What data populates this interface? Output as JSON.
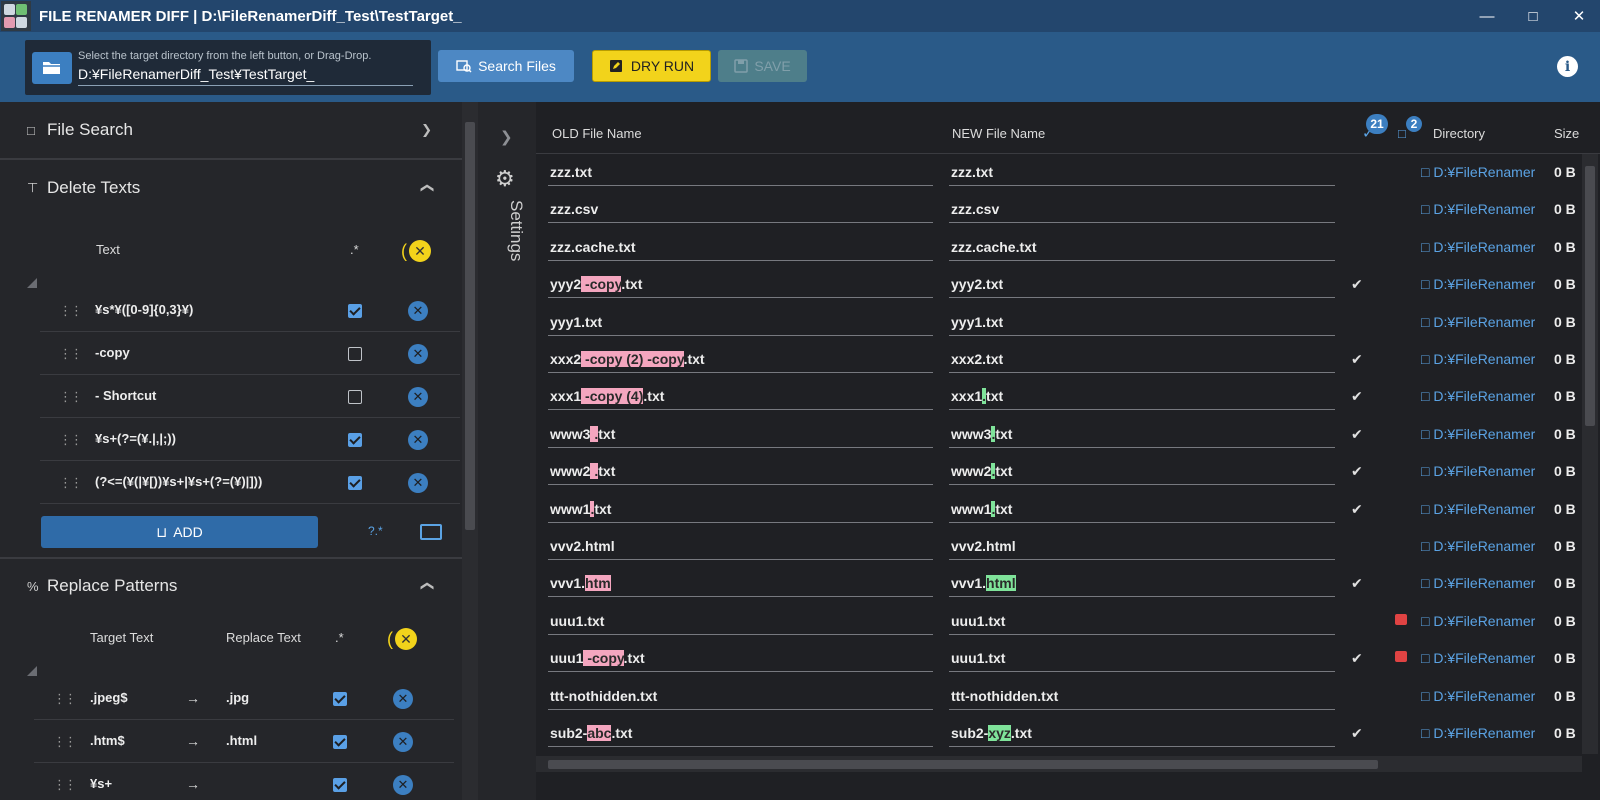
{
  "window": {
    "title": "FILE RENAMER DIFF | D:\\FileRenamerDiff_Test\\TestTarget_",
    "minimize_icon": "minimize-icon",
    "maximize_icon": "maximize-icon",
    "close_icon": "close-icon"
  },
  "toolbar": {
    "dir_hint": "Select the target directory from the left button, or Drag-Drop.",
    "dir_value": "D:¥FileRenamerDiff_Test¥TestTarget_",
    "search_label": "Search Files",
    "dryrun_label": "DRY RUN",
    "save_label": "SAVE"
  },
  "left": {
    "file_search": {
      "title": "File Search",
      "expanded": false
    },
    "delete_texts": {
      "title": "Delete Texts",
      "col_text": "Text",
      "col_regex": ".*",
      "items": [
        {
          "text": "¥s*¥([0-9]{0,3}¥)",
          "regex": true
        },
        {
          "text": " -copy",
          "regex": false
        },
        {
          "text": "- Shortcut",
          "regex": false
        },
        {
          "text": "¥s+(?=(¥.|,|;))",
          "regex": true
        },
        {
          "text": "(?<=(¥(|¥[))¥s+|¥s+(?=(¥)|]))",
          "regex": true
        }
      ],
      "add_label": "ADD",
      "help_label": "?.*"
    },
    "replace_patterns": {
      "title": "Replace Patterns",
      "col_target": "Target Text",
      "col_replace": "Replace Text",
      "col_regex": ".*",
      "items": [
        {
          "target": ".jpeg$",
          "replace": ".jpg",
          "regex": true
        },
        {
          "target": ".htm$",
          "replace": ".html",
          "regex": true
        },
        {
          "target": "¥s+",
          "replace": "",
          "regex": true
        }
      ]
    }
  },
  "settings": {
    "label": "Settings"
  },
  "grid": {
    "headers": {
      "old": "OLD File Name",
      "new": "NEW File Name",
      "directory": "Directory",
      "size": "Size"
    },
    "check_count": "21",
    "warn_count": "2",
    "rows": [
      {
        "old": [
          [
            "zzz.txt",
            ""
          ]
        ],
        "new": [
          [
            "zzz.txt",
            ""
          ]
        ],
        "changed": false,
        "warn": false,
        "dir": "D:¥FileRenamerDiff_Test¥TestTarget_",
        "size": "0 B"
      },
      {
        "old": [
          [
            "zzz.csv",
            ""
          ]
        ],
        "new": [
          [
            "zzz.csv",
            ""
          ]
        ],
        "changed": false,
        "warn": false,
        "dir": "D:¥FileRenamerDiff_Test¥TestTarget_",
        "size": "0 B"
      },
      {
        "old": [
          [
            "zzz.cache.txt",
            ""
          ]
        ],
        "new": [
          [
            "zzz.cache.txt",
            ""
          ]
        ],
        "changed": false,
        "warn": false,
        "dir": "D:¥FileRenamerDiff_Test¥TestTarget_",
        "size": "0 B"
      },
      {
        "old": [
          [
            "yyy2",
            ""
          ],
          [
            " -copy",
            "d"
          ],
          [
            ".txt",
            ""
          ]
        ],
        "new": [
          [
            "yyy2.txt",
            ""
          ]
        ],
        "changed": true,
        "warn": false,
        "dir": "D:¥FileRenamerDiff_Test¥TestTarget_",
        "size": "0 B"
      },
      {
        "old": [
          [
            "yyy1.txt",
            ""
          ]
        ],
        "new": [
          [
            "yyy1.txt",
            ""
          ]
        ],
        "changed": false,
        "warn": false,
        "dir": "D:¥FileRenamerDiff_Test¥TestTarget_",
        "size": "0 B"
      },
      {
        "old": [
          [
            "xxx2",
            ""
          ],
          [
            " -copy (2) -copy",
            "d"
          ],
          [
            ".txt",
            ""
          ]
        ],
        "new": [
          [
            "xxx2.txt",
            ""
          ]
        ],
        "changed": true,
        "warn": false,
        "dir": "D:¥FileRenamerDiff_Test¥TestTarget_",
        "size": "0 B"
      },
      {
        "old": [
          [
            "xxx1",
            ""
          ],
          [
            " -copy (4)",
            "d"
          ],
          [
            ".txt",
            ""
          ]
        ],
        "new": [
          [
            "xxx1",
            ""
          ],
          [
            ".",
            "i"
          ],
          [
            "txt",
            ""
          ]
        ],
        "changed": true,
        "warn": false,
        "dir": "D:¥FileRenamerDiff_Test¥TestTarget_",
        "size": "0 B"
      },
      {
        "old": [
          [
            "www3",
            ""
          ],
          [
            "  .",
            "d"
          ],
          [
            "txt",
            ""
          ]
        ],
        "new": [
          [
            "www3",
            ""
          ],
          [
            ".",
            "i"
          ],
          [
            "txt",
            ""
          ]
        ],
        "changed": true,
        "warn": false,
        "dir": "D:¥FileRenamerDiff_Test¥TestTarget_",
        "size": "0 B"
      },
      {
        "old": [
          [
            "www2",
            ""
          ],
          [
            " .",
            "d"
          ],
          [
            "txt",
            ""
          ]
        ],
        "new": [
          [
            "www2",
            ""
          ],
          [
            ".",
            "i"
          ],
          [
            "txt",
            ""
          ]
        ],
        "changed": true,
        "warn": false,
        "dir": "D:¥FileRenamerDiff_Test¥TestTarget_",
        "size": "0 B"
      },
      {
        "old": [
          [
            "www1",
            ""
          ],
          [
            ".",
            "d"
          ],
          [
            "txt",
            ""
          ]
        ],
        "new": [
          [
            "www1",
            ""
          ],
          [
            ".",
            "i"
          ],
          [
            "txt",
            ""
          ]
        ],
        "changed": true,
        "warn": false,
        "dir": "D:¥FileRenamerDiff_Test¥TestTarget_",
        "size": "0 B"
      },
      {
        "old": [
          [
            "vvv2.html",
            ""
          ]
        ],
        "new": [
          [
            "vvv2.html",
            ""
          ]
        ],
        "changed": false,
        "warn": false,
        "dir": "D:¥FileRenamerDiff_Test¥TestTarget_",
        "size": "0 B"
      },
      {
        "old": [
          [
            "vvv1.",
            ""
          ],
          [
            "htm",
            "d"
          ]
        ],
        "new": [
          [
            "vvv1.",
            ""
          ],
          [
            "html",
            "i"
          ]
        ],
        "changed": true,
        "warn": false,
        "dir": "D:¥FileRenamerDiff_Test¥TestTarget_",
        "size": "0 B"
      },
      {
        "old": [
          [
            "uuu1.txt",
            ""
          ]
        ],
        "new": [
          [
            "uuu1.txt",
            ""
          ]
        ],
        "changed": false,
        "warn": true,
        "dir": "D:¥FileRenamerDiff_Test¥TestTarget_",
        "size": "0 B"
      },
      {
        "old": [
          [
            "uuu1",
            ""
          ],
          [
            " -copy",
            "d"
          ],
          [
            ".txt",
            ""
          ]
        ],
        "new": [
          [
            "uuu1.txt",
            ""
          ]
        ],
        "changed": true,
        "warn": true,
        "dir": "D:¥FileRenamerDiff_Test¥TestTarget_",
        "size": "0 B"
      },
      {
        "old": [
          [
            "ttt-nothidden.txt",
            ""
          ]
        ],
        "new": [
          [
            "ttt-nothidden.txt",
            ""
          ]
        ],
        "changed": false,
        "warn": false,
        "dir": "D:¥FileRenamerDiff_Test¥TestTarget_",
        "size": "0 B"
      },
      {
        "old": [
          [
            "sub2-",
            ""
          ],
          [
            "abc",
            "d"
          ],
          [
            ".txt",
            ""
          ]
        ],
        "new": [
          [
            "sub2-",
            ""
          ],
          [
            "xyz",
            "i"
          ],
          [
            ".txt",
            ""
          ]
        ],
        "changed": true,
        "warn": false,
        "dir": "D:¥FileRenamerDiff_Test¥TestTarget_",
        "size": "0 B"
      }
    ]
  }
}
